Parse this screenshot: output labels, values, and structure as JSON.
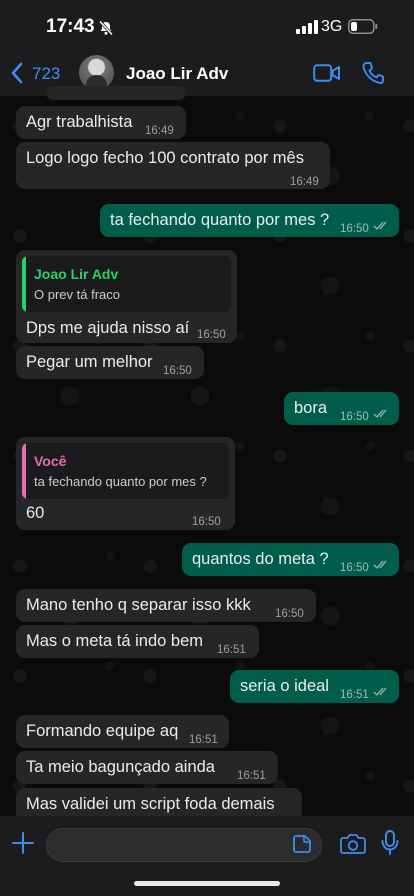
{
  "status_bar": {
    "time": "17:43",
    "network": "3G"
  },
  "header": {
    "back_count": "723",
    "contact_name": "Joao Lir Adv"
  },
  "messages": [
    {
      "text": "Agr trabalhista",
      "time": "16:49"
    },
    {
      "text": "Logo logo fecho 100 contrato por mês",
      "time": "16:49"
    },
    {
      "text": "ta fechando quanto por mes ?",
      "time": "16:50"
    },
    {
      "quote_name": "Joao Lir Adv",
      "quote_text": "O prev tá fraco",
      "text": "Dps me ajuda nisso aí",
      "time": "16:50"
    },
    {
      "text": "Pegar um melhor",
      "time": "16:50"
    },
    {
      "text": "bora",
      "time": "16:50"
    },
    {
      "quote_name": "Você",
      "quote_text": "ta fechando quanto por mes ?",
      "text": "60",
      "time": "16:50"
    },
    {
      "text": "quantos do meta ?",
      "time": "16:50"
    },
    {
      "text": "Mano tenho q separar isso kkk",
      "time": "16:50"
    },
    {
      "text": "Mas o meta tá indo bem",
      "time": "16:51"
    },
    {
      "text": "seria o ideal",
      "time": "16:51"
    },
    {
      "text": "Formando equipe aq",
      "time": "16:51"
    },
    {
      "text": "Ta meio bagunçado ainda",
      "time": "16:51"
    },
    {
      "text": "Mas validei um script foda demais",
      "time": ""
    }
  ],
  "colors": {
    "outgoing_bubble": "#005c4b",
    "incoming_bubble": "#262628",
    "accent_blue": "#3b8ef0",
    "quote_green": "#25d366",
    "quote_pink": "#e56db1"
  },
  "icons": [
    "bell-slash-icon",
    "signal-icon",
    "battery-icon",
    "back-chevron-icon",
    "video-call-icon",
    "phone-icon",
    "read-ticks-icon",
    "plus-icon",
    "sticker-icon",
    "camera-icon",
    "microphone-icon"
  ]
}
